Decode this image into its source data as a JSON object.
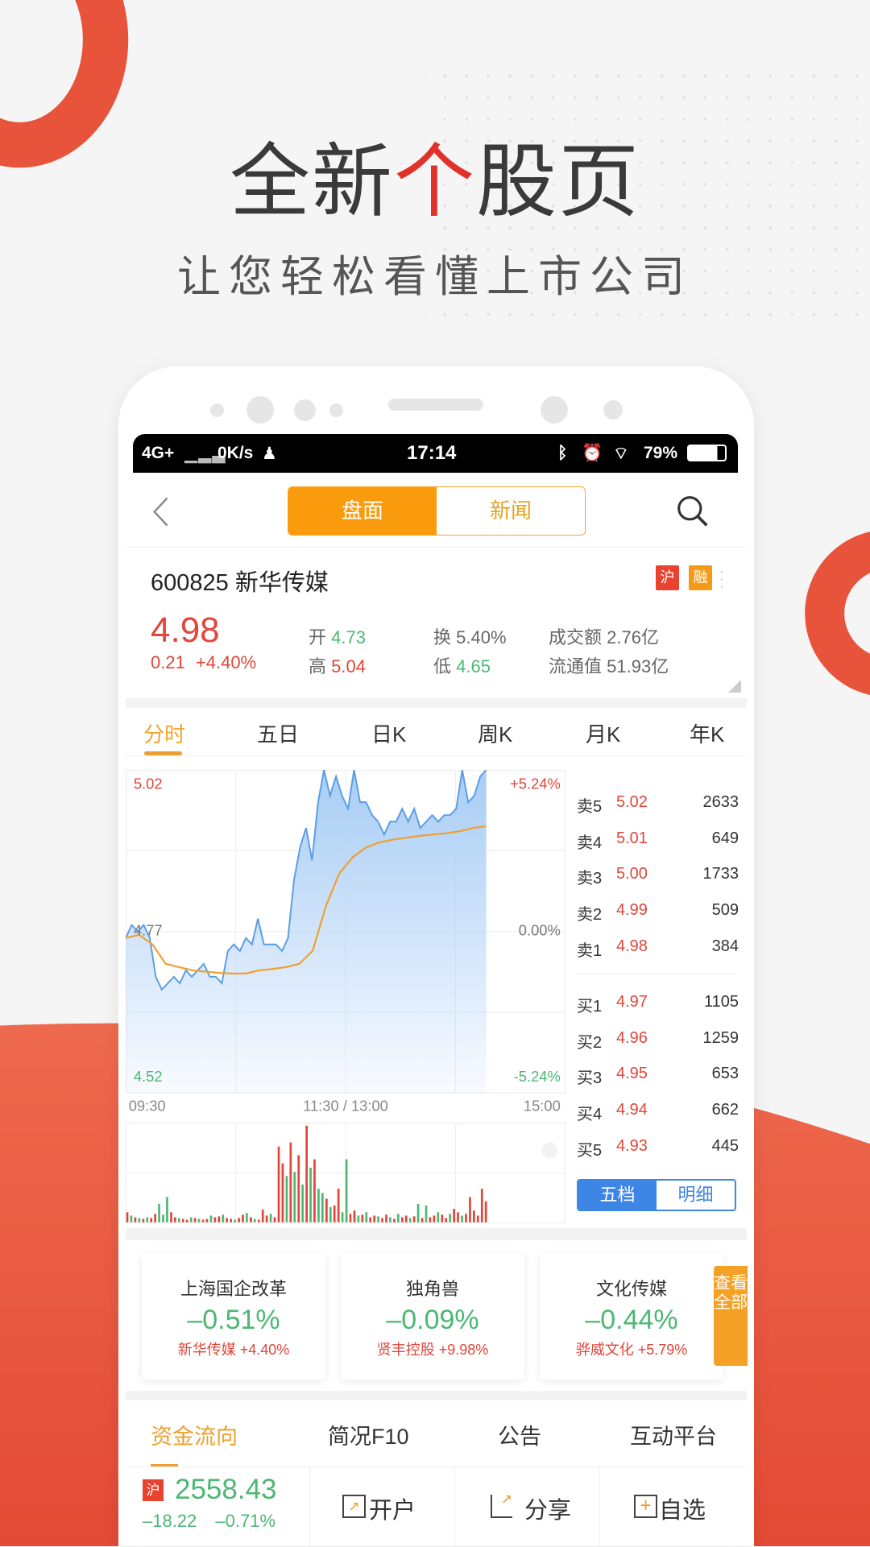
{
  "promo": {
    "title_pre": "全新",
    "title_accent": "个",
    "title_post": "股页",
    "subtitle": "让您轻松看懂上市公司"
  },
  "status_bar": {
    "network": "4G+",
    "speed": "0K/s",
    "time": "17:14",
    "battery": "79%"
  },
  "nav": {
    "segments": [
      "盘面",
      "新闻"
    ],
    "active": 0
  },
  "stock": {
    "code_name": "600825 新华传媒",
    "tags": [
      {
        "label": "沪",
        "color": "#e8432f"
      },
      {
        "label": "融",
        "color": "#f59a16"
      }
    ],
    "price": "4.98",
    "change": "0.21",
    "change_pct": "+4.40%",
    "open_label": "开",
    "open": "4.73",
    "high_label": "高",
    "high": "5.04",
    "turnover_label": "换",
    "turnover": "5.40%",
    "low_label": "低",
    "low": "4.65",
    "amount_label": "成交额",
    "amount": "2.76亿",
    "float_label": "流通值",
    "float_value": "51.93亿"
  },
  "chart_tabs": [
    "分时",
    "五日",
    "日K",
    "周K",
    "月K",
    "年K"
  ],
  "chart_data": {
    "type": "line",
    "y_max_label": "5.02",
    "y_mid_label": "4.77",
    "y_min_label": "4.52",
    "pct_max_label": "+5.24%",
    "pct_mid_label": "0.00%",
    "pct_min_label": "-5.24%",
    "x_labels": [
      "09:30",
      "11:30 / 13:00",
      "15:00"
    ],
    "ylim": [
      4.52,
      5.02
    ],
    "price": [
      4.76,
      4.78,
      4.77,
      4.78,
      4.76,
      4.7,
      4.68,
      4.69,
      4.7,
      4.69,
      4.71,
      4.7,
      4.71,
      4.72,
      4.7,
      4.7,
      4.69,
      4.74,
      4.75,
      4.74,
      4.76,
      4.75,
      4.79,
      4.75,
      4.75,
      4.75,
      4.74,
      4.76,
      4.85,
      4.9,
      4.93,
      4.88,
      4.97,
      5.02,
      4.98,
      5.01,
      4.98,
      4.96,
      5.02,
      4.97,
      4.97,
      4.95,
      4.94,
      4.92,
      4.94,
      4.94,
      4.96,
      4.94,
      4.96,
      4.93,
      4.94,
      4.95,
      4.94,
      4.95,
      4.95,
      4.96,
      5.02,
      4.97,
      4.98,
      5.01,
      5.02
    ],
    "avg": [
      4.76,
      4.765,
      4.75,
      4.72,
      4.715,
      4.71,
      4.708,
      4.706,
      4.705,
      4.705,
      4.71,
      4.712,
      4.715,
      4.72,
      4.74,
      4.81,
      4.86,
      4.885,
      4.9,
      4.908,
      4.912,
      4.915,
      4.918,
      4.92,
      4.922,
      4.925,
      4.93,
      4.933
    ],
    "session_fraction": 0.82,
    "volume": [
      12,
      -8,
      6,
      -5,
      4,
      -6,
      5,
      10,
      -22,
      -9,
      -30,
      12,
      6,
      -5,
      4,
      3,
      -6,
      5,
      -4,
      3,
      4,
      -8,
      6,
      7,
      -9,
      5,
      4,
      -3,
      5,
      9,
      -11,
      6,
      -4,
      3,
      15,
      8,
      -10,
      6,
      90,
      70,
      -55,
      95,
      -60,
      80,
      -45,
      115,
      -65,
      75,
      -40,
      -35,
      28,
      -18,
      20,
      40,
      -12,
      -75,
      10,
      14,
      -8,
      9,
      -12,
      6,
      8,
      -7,
      5,
      9,
      -6,
      4,
      -10,
      6,
      8,
      -5,
      7,
      -22,
      5,
      -20,
      6,
      8,
      -12,
      9,
      5,
      -10,
      16,
      12,
      -8,
      10,
      30,
      14,
      8,
      40,
      25
    ],
    "volume_colors": {
      "up": "#e0463a",
      "down": "#4cb872",
      "neutral": "#8a8a8a"
    },
    "line_color": "#5b9de6",
    "avg_color": "#f0a030"
  },
  "order_book": {
    "asks": [
      {
        "label": "卖5",
        "price": "5.02",
        "vol": "2633"
      },
      {
        "label": "卖4",
        "price": "5.01",
        "vol": "649"
      },
      {
        "label": "卖3",
        "price": "5.00",
        "vol": "1733"
      },
      {
        "label": "卖2",
        "price": "4.99",
        "vol": "509"
      },
      {
        "label": "卖1",
        "price": "4.98",
        "vol": "384"
      }
    ],
    "bids": [
      {
        "label": "买1",
        "price": "4.97",
        "vol": "1105"
      },
      {
        "label": "买2",
        "price": "4.96",
        "vol": "1259"
      },
      {
        "label": "买3",
        "price": "4.95",
        "vol": "653"
      },
      {
        "label": "买4",
        "price": "4.94",
        "vol": "662"
      },
      {
        "label": "买5",
        "price": "4.93",
        "vol": "445"
      }
    ],
    "toggle": [
      "五档",
      "明细"
    ]
  },
  "sectors": [
    {
      "name": "上海国企改革",
      "pct": "–0.51%",
      "leader": "新华传媒 +4.40%"
    },
    {
      "name": "独角兽",
      "pct": "–0.09%",
      "leader": "贤丰控股 +9.98%"
    },
    {
      "name": "文化传媒",
      "pct": "–0.44%",
      "leader": "骅威文化 +5.79%"
    }
  ],
  "view_all": "查看全部",
  "bottom_tabs": [
    "资金流向",
    "简况F10",
    "公告",
    "互动平台"
  ],
  "index": {
    "tag": "沪",
    "value": "2558.43",
    "change": "–18.22",
    "pct": "–0.71%"
  },
  "actions": [
    "开户",
    "分享",
    "自选"
  ],
  "colors": {
    "red": "#e0463a",
    "green": "#4cb872",
    "orange": "#f99b0c",
    "blue": "#3d86e6",
    "accent": "#e8533c"
  }
}
